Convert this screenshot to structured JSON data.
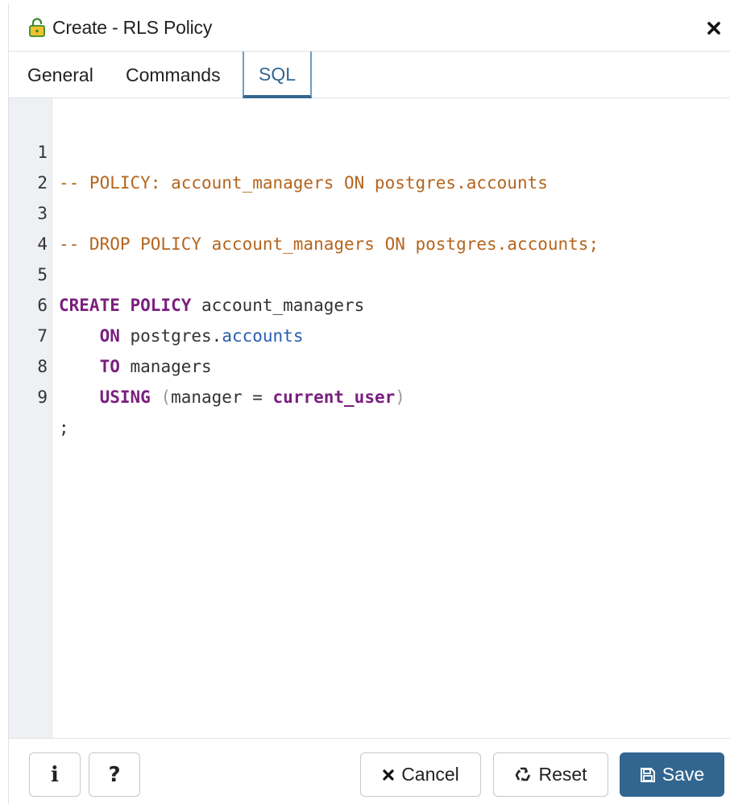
{
  "dialog": {
    "title": "Create - RLS Policy",
    "title_icon": "lock-icon",
    "close_icon": "close-icon"
  },
  "tabs": [
    {
      "label": "General",
      "active": false
    },
    {
      "label": "Commands",
      "active": false
    },
    {
      "label": "SQL",
      "active": true
    }
  ],
  "editor": {
    "lines": [
      {
        "num": "1",
        "text": "-- POLICY: account_managers ON postgres.accounts"
      },
      {
        "num": "2",
        "text": ""
      },
      {
        "num": "3",
        "text": "-- DROP POLICY account_managers ON postgres.accounts;"
      },
      {
        "num": "4",
        "text": ""
      },
      {
        "num": "5",
        "text": "CREATE POLICY account_managers"
      },
      {
        "num": "6",
        "text": "    ON postgres.accounts"
      },
      {
        "num": "7",
        "text": "    TO managers"
      },
      {
        "num": "8",
        "text": "    USING (manager = current_user)"
      },
      {
        "num": "9",
        "text": ";"
      }
    ],
    "tokens": {
      "l5_kw": "CREATE POLICY",
      "l5_rest": " account_managers",
      "l6_kw": "ON",
      "l6_schema": " postgres.",
      "l6_table": "accounts",
      "l7_kw": "TO",
      "l7_rest": " managers",
      "l8_kw": "USING",
      "l8_open": " (",
      "l8_mid": "manager = ",
      "l8_fn": "current_user",
      "l8_close": ")"
    }
  },
  "footer": {
    "info_icon": "info-icon",
    "help_icon": "help-icon",
    "cancel_label": "Cancel",
    "reset_label": "Reset",
    "save_label": "Save"
  },
  "colors": {
    "accent": "#326690",
    "comment": "#b5651d",
    "keyword": "#7a1e7f",
    "identifier": "#2a5db0",
    "gutter": "#eef0f3"
  }
}
